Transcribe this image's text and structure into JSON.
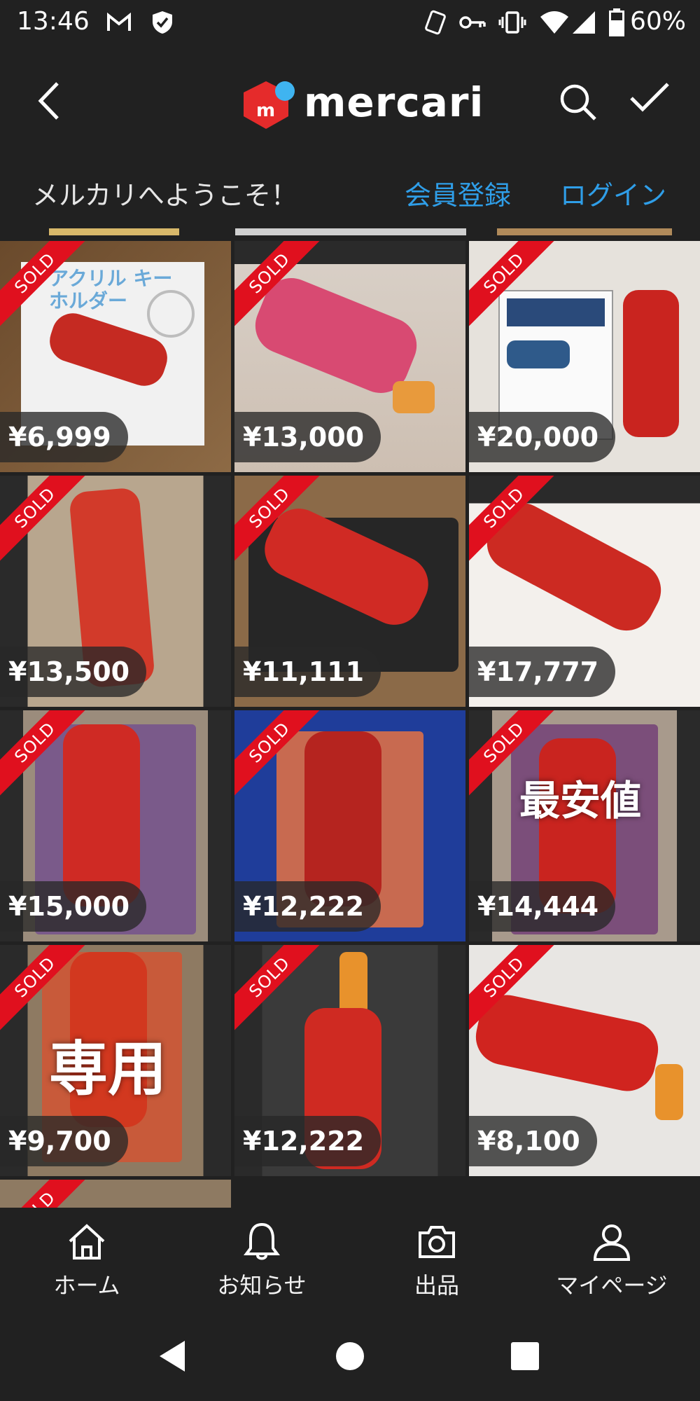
{
  "status_bar": {
    "time": "13:46",
    "battery": "60%"
  },
  "app_bar": {
    "logo_text": "mercari"
  },
  "welcome_bar": {
    "message": "メルカリへようこそ！",
    "register_link": "会員登録",
    "login_link": "ログイン"
  },
  "colors": {
    "background": "#212121",
    "accent_blue": "#2f9ee8",
    "sold_red": "#e0101e",
    "logo_red": "#e52b2b",
    "logo_blue": "#3fb4f0"
  },
  "items": [
    {
      "price": "¥6,999",
      "sold_label": "SOLD",
      "overlay": ""
    },
    {
      "price": "¥13,000",
      "sold_label": "SOLD",
      "overlay": ""
    },
    {
      "price": "¥20,000",
      "sold_label": "SOLD",
      "overlay": ""
    },
    {
      "price": "¥13,500",
      "sold_label": "SOLD",
      "overlay": ""
    },
    {
      "price": "¥11,111",
      "sold_label": "SOLD",
      "overlay": ""
    },
    {
      "price": "¥17,777",
      "sold_label": "SOLD",
      "overlay": ""
    },
    {
      "price": "¥15,000",
      "sold_label": "SOLD",
      "overlay": ""
    },
    {
      "price": "¥12,222",
      "sold_label": "SOLD",
      "overlay": ""
    },
    {
      "price": "¥14,444",
      "sold_label": "SOLD",
      "overlay": "最安値"
    },
    {
      "price": "¥9,700",
      "sold_label": "SOLD",
      "overlay": "専用"
    },
    {
      "price": "¥12,222",
      "sold_label": "SOLD",
      "overlay": ""
    },
    {
      "price": "¥8,100",
      "sold_label": "SOLD",
      "overlay": ""
    }
  ],
  "item_image_texts": {
    "item1_card": "アクリル キーホルダー"
  },
  "bottom_nav": {
    "home": "ホーム",
    "notifications": "お知らせ",
    "sell": "出品",
    "mypage": "マイページ"
  },
  "icons": {
    "back": "back-arrow-icon",
    "search": "search-icon",
    "check": "checkmark-icon",
    "home": "home-icon",
    "bell": "bell-icon",
    "camera": "camera-icon",
    "person": "person-icon"
  }
}
